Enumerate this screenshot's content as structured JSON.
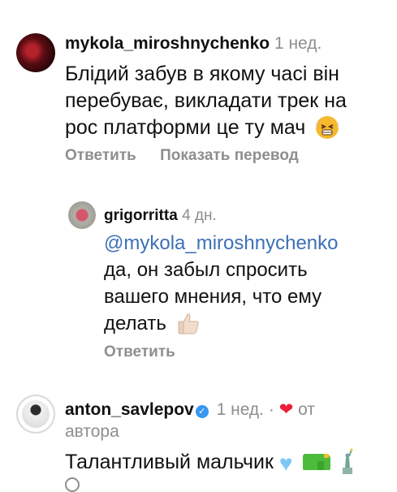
{
  "comments": [
    {
      "username": "mykola_miroshnychenko",
      "time": "1 нед.",
      "text": "Блідий забув в якому часі він перебуває, викладати трек на рос платформи це ту мач",
      "emoji": "tired-face",
      "actions": {
        "reply": "Ответить",
        "translate": "Показать перевод"
      }
    },
    {
      "username": "anton_savlepov",
      "verified": true,
      "time": "1 нед.",
      "separator": "·",
      "author_like": "от автора",
      "text": "Талантливый мальчик"
    }
  ],
  "reply": {
    "username": "grigorritta",
    "time": "4 дн.",
    "mention": "@mykola_miroshnychenko",
    "text": "да, он забыл спросить вашего мнения, что ему делать",
    "action_reply": "Ответить"
  },
  "colors": {
    "link": "#3d6fb7",
    "meta": "#8e8e8e",
    "heart": "#ed1c3a",
    "verified": "#3897f0"
  }
}
